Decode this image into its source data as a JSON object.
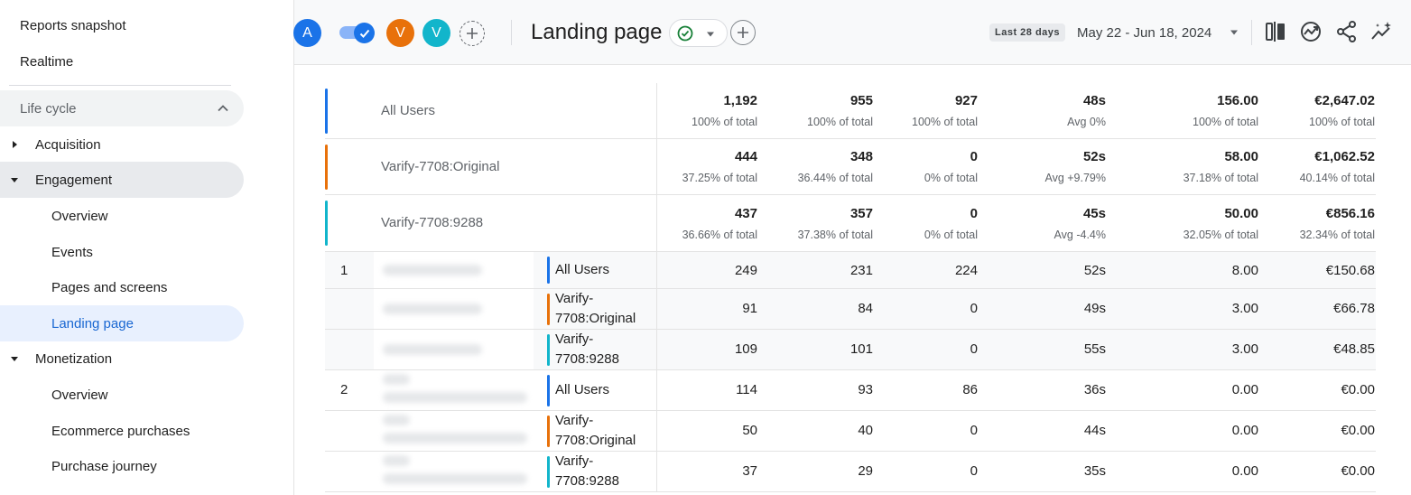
{
  "sidebar": {
    "top_items": [
      "Reports snapshot",
      "Realtime"
    ],
    "section_label": "Life cycle",
    "acquisition": "Acquisition",
    "engagement": "Engagement",
    "engagement_items": [
      "Overview",
      "Events",
      "Pages and screens",
      "Landing page"
    ],
    "monetization": "Monetization",
    "monetization_items": [
      "Overview",
      "Ecommerce purchases",
      "Purchase journey"
    ]
  },
  "toolbar": {
    "avatars": [
      {
        "letter": "A",
        "color": "#1a73e8"
      },
      {
        "letter": "V",
        "color": "#e8710a"
      },
      {
        "letter": "V",
        "color": "#12b5cb"
      }
    ],
    "title": "Landing page",
    "date_badge": "Last 28 days",
    "date_range": "May 22 - Jun 18, 2024"
  },
  "colors": {
    "all_users": "#1a73e8",
    "original": "#e8710a",
    "variant": "#12b5cb"
  },
  "summary_rows": [
    {
      "segment": "All Users",
      "color": "#1a73e8",
      "values": [
        "1,192",
        "955",
        "927",
        "48s",
        "156.00",
        "€2,647.02"
      ],
      "pcts": [
        "100% of total",
        "100% of total",
        "100% of total",
        "Avg 0%",
        "100% of total",
        "100% of total"
      ]
    },
    {
      "segment": "Varify-7708:Original",
      "color": "#e8710a",
      "values": [
        "444",
        "348",
        "0",
        "52s",
        "58.00",
        "€1,062.52"
      ],
      "pcts": [
        "37.25% of total",
        "36.44% of total",
        "0% of total",
        "Avg +9.79%",
        "37.18% of total",
        "40.14% of total"
      ]
    },
    {
      "segment": "Varify-7708:9288",
      "color": "#12b5cb",
      "values": [
        "437",
        "357",
        "0",
        "45s",
        "50.00",
        "€856.16"
      ],
      "pcts": [
        "36.66% of total",
        "37.38% of total",
        "0% of total",
        "Avg -4.4%",
        "32.05% of total",
        "32.34% of total"
      ]
    }
  ],
  "data_rows": [
    {
      "num": "1",
      "segment": "All Users",
      "color": "#1a73e8",
      "values": [
        "249",
        "231",
        "224",
        "52s",
        "8.00",
        "€150.68"
      ]
    },
    {
      "num": "",
      "segment": "Varify-7708:Original",
      "color": "#e8710a",
      "values": [
        "91",
        "84",
        "0",
        "49s",
        "3.00",
        "€66.78"
      ]
    },
    {
      "num": "",
      "segment": "Varify-7708:9288",
      "color": "#12b5cb",
      "values": [
        "109",
        "101",
        "0",
        "55s",
        "3.00",
        "€48.85"
      ]
    },
    {
      "num": "2",
      "segment": "All Users",
      "color": "#1a73e8",
      "values": [
        "114",
        "93",
        "86",
        "36s",
        "0.00",
        "€0.00"
      ]
    },
    {
      "num": "",
      "segment": "Varify-7708:Original",
      "color": "#e8710a",
      "values": [
        "50",
        "40",
        "0",
        "44s",
        "0.00",
        "€0.00"
      ]
    },
    {
      "num": "",
      "segment": "Varify-7708:9288",
      "color": "#12b5cb",
      "values": [
        "37",
        "29",
        "0",
        "35s",
        "0.00",
        "€0.00"
      ]
    }
  ]
}
